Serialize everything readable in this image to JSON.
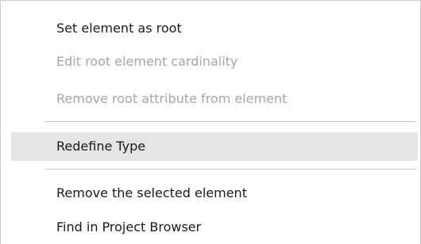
{
  "context_menu": {
    "items": [
      {
        "label": "Set element as root",
        "enabled": true
      },
      {
        "label": "Edit root element cardinality",
        "enabled": false
      },
      {
        "label": "Remove root attribute from element",
        "enabled": false
      },
      {
        "label": "Redefine Type",
        "enabled": true,
        "highlighted": true
      },
      {
        "label": "Remove the selected element",
        "enabled": true
      },
      {
        "label": "Find in Project Browser",
        "enabled": true
      }
    ]
  }
}
